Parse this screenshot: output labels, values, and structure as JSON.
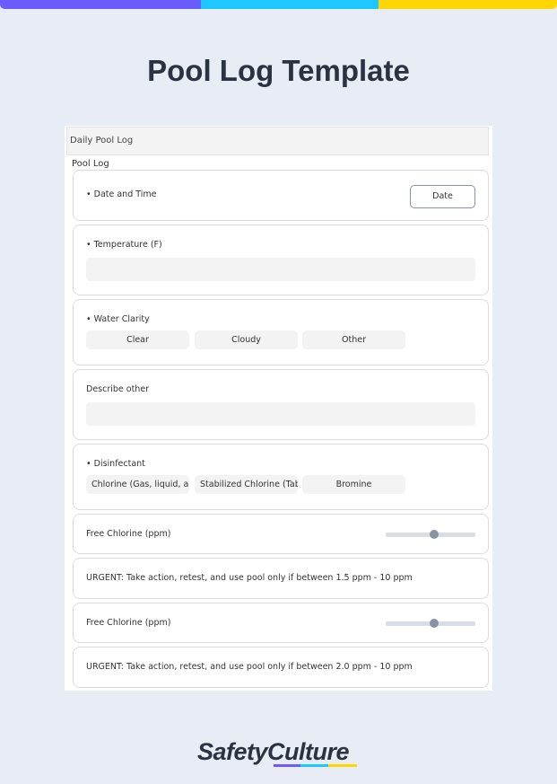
{
  "colors": {
    "purple": "#6c5cff",
    "cyan": "#1ec8ff",
    "yellow": "#ffd600",
    "background": "#e8ecf5",
    "title": "#2b3342"
  },
  "title": "Pool Log Template",
  "form": {
    "header": "Daily Pool Log",
    "section": "Pool Log",
    "date_time": {
      "label": "• Date and Time",
      "button": "Date"
    },
    "temperature": {
      "label": "• Temperature (F)",
      "value": ""
    },
    "water_clarity": {
      "label": "• Water Clarity",
      "options": [
        "Clear",
        "Cloudy",
        "Other"
      ]
    },
    "describe_other": {
      "label": "Describe other",
      "value": ""
    },
    "disinfectant": {
      "label": "• Disinfectant",
      "options": [
        "Chlorine (Gas, liquid, an",
        "Stabilized Chlorine (Tabl",
        "Bromine"
      ]
    },
    "free_chlorine_1": {
      "label": "Free Chlorine (ppm)",
      "slider_percent": 54
    },
    "urgent_1": "URGENT: Take action, retest, and use pool only if between 1.5 ppm - 10 ppm",
    "free_chlorine_2": {
      "label": "Free Chlorine (ppm)",
      "slider_percent": 54
    },
    "urgent_2": "URGENT: Take action, retest, and use pool only if between 2.0 ppm - 10 ppm"
  },
  "logo": "SafetyCulture"
}
